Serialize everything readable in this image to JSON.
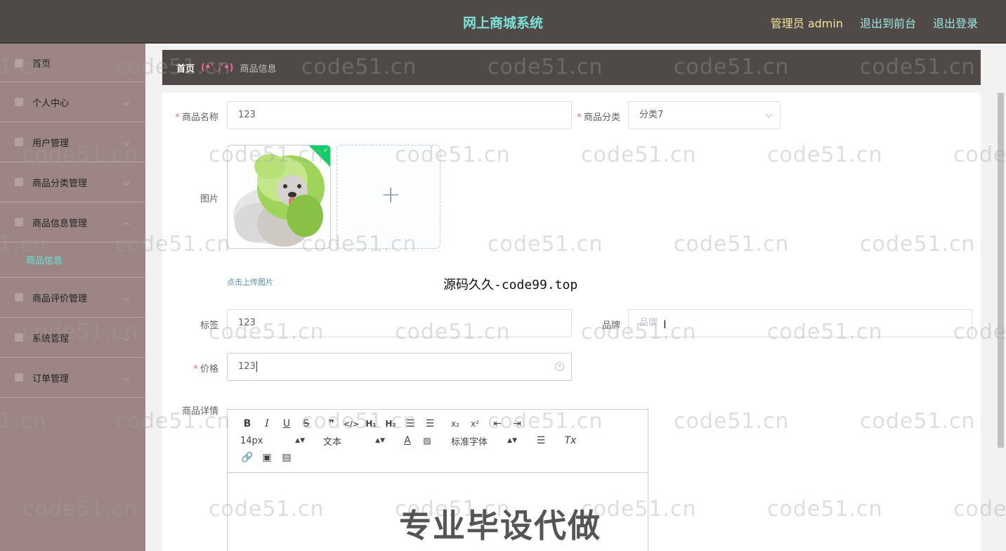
{
  "header": {
    "title": "网上商城系统",
    "admin_label": "管理员 admin",
    "to_front": "退出到前台",
    "logout": "退出登录"
  },
  "sidebar": {
    "items": [
      {
        "label": "首页"
      },
      {
        "label": "个人中心"
      },
      {
        "label": "用户管理"
      },
      {
        "label": "商品分类管理"
      },
      {
        "label": "商品信息管理"
      },
      {
        "label": "商品评价管理"
      },
      {
        "label": "系统管理"
      },
      {
        "label": "订单管理"
      }
    ],
    "active_sub": "商品信息"
  },
  "breadcrumb": {
    "home": "首页",
    "sep": "(•'◡'•)",
    "current": "商品信息"
  },
  "form": {
    "name_label": "商品名称",
    "name_value": "123",
    "category_label": "商品分类",
    "category_value": "分类7",
    "image_label": "图片",
    "upload_tip": "点击上传图片",
    "tag_label": "标签",
    "tag_value": "123",
    "brand_label": "品牌",
    "brand_placeholder": "品牌",
    "price_label": "价格",
    "price_value": "123",
    "detail_label": "商品详情"
  },
  "editor": {
    "font_size": "14px",
    "text_type": "文本",
    "font_family": "标准字体"
  },
  "watermarks": {
    "repeat": "code51.cn",
    "edge": "1.cn",
    "edge_right": "code",
    "center": "源码久久-code99.top",
    "big": "专业毕设代做"
  }
}
